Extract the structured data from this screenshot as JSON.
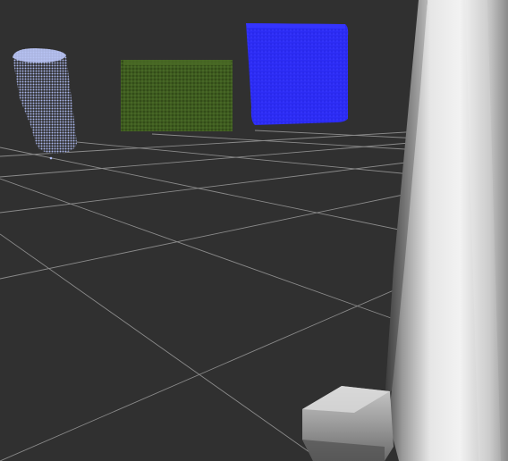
{
  "scene": {
    "background_color": "#303030",
    "grid_color": "#a0a0a0",
    "objects": [
      {
        "id": "cylinder",
        "kind": "point-cloud-cylinder",
        "color": "#a9b6f0"
      },
      {
        "id": "green-box",
        "kind": "point-cloud-box",
        "color": "#3d5a1f"
      },
      {
        "id": "blue-box",
        "kind": "point-cloud-box",
        "color": "#2a2af2"
      },
      {
        "id": "robot-link",
        "kind": "mesh",
        "color": "#dcdcdc"
      }
    ]
  }
}
